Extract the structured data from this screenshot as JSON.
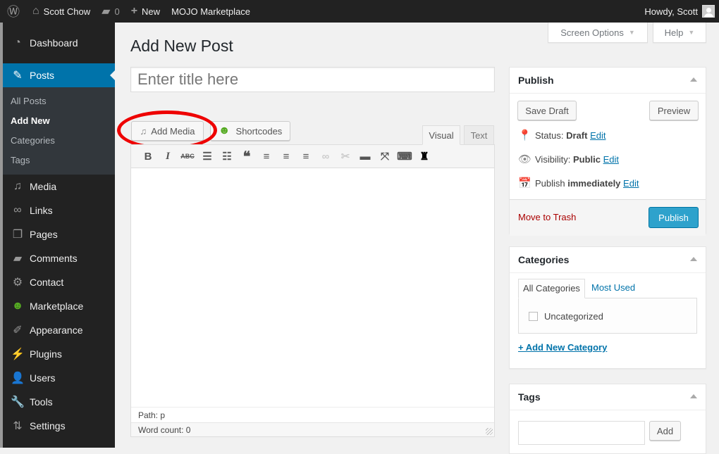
{
  "admin_bar": {
    "site_name": "Scott Chow",
    "comments": "0",
    "new_label": "New",
    "marketplace": "MOJO Marketplace",
    "greeting": "Howdy, Scott"
  },
  "screen_options": "Screen Options",
  "help": "Help",
  "sidebar": {
    "items": [
      {
        "label": "Dashboard"
      },
      {
        "label": "Posts"
      },
      {
        "label": "Media"
      },
      {
        "label": "Links"
      },
      {
        "label": "Pages"
      },
      {
        "label": "Comments"
      },
      {
        "label": "Contact"
      },
      {
        "label": "Marketplace"
      },
      {
        "label": "Appearance"
      },
      {
        "label": "Plugins"
      },
      {
        "label": "Users"
      },
      {
        "label": "Tools"
      },
      {
        "label": "Settings"
      }
    ],
    "posts_sub": [
      {
        "label": "All Posts"
      },
      {
        "label": "Add New"
      },
      {
        "label": "Categories"
      },
      {
        "label": "Tags"
      }
    ]
  },
  "page_title": "Add New Post",
  "title_placeholder": "Enter title here",
  "add_media": "Add Media",
  "shortcodes": "Shortcodes",
  "editor_tabs": {
    "visual": "Visual",
    "text": "Text"
  },
  "toolbar": [
    "B",
    "I",
    "ABC",
    "☰",
    "≡",
    "❝",
    "≡",
    "≡",
    "≡",
    "🔗",
    "✂",
    "▬",
    "⤢",
    "⌨",
    "☻"
  ],
  "path": "Path: p",
  "word_count": "Word count: 0",
  "publish": {
    "title": "Publish",
    "save_draft": "Save Draft",
    "preview": "Preview",
    "status_label": "Status:",
    "status": "Draft",
    "visibility_label": "Visibility:",
    "visibility": "Public",
    "publish_label": "Publish",
    "publish_when": "immediately",
    "edit": "Edit",
    "trash": "Move to Trash",
    "publish_btn": "Publish"
  },
  "categories": {
    "title": "Categories",
    "tab_all": "All Categories",
    "tab_most": "Most Used",
    "items": [
      {
        "label": "Uncategorized",
        "checked": false
      }
    ],
    "add_new": "+ Add New Category"
  },
  "tags": {
    "title": "Tags",
    "add": "Add",
    "input_value": ""
  }
}
